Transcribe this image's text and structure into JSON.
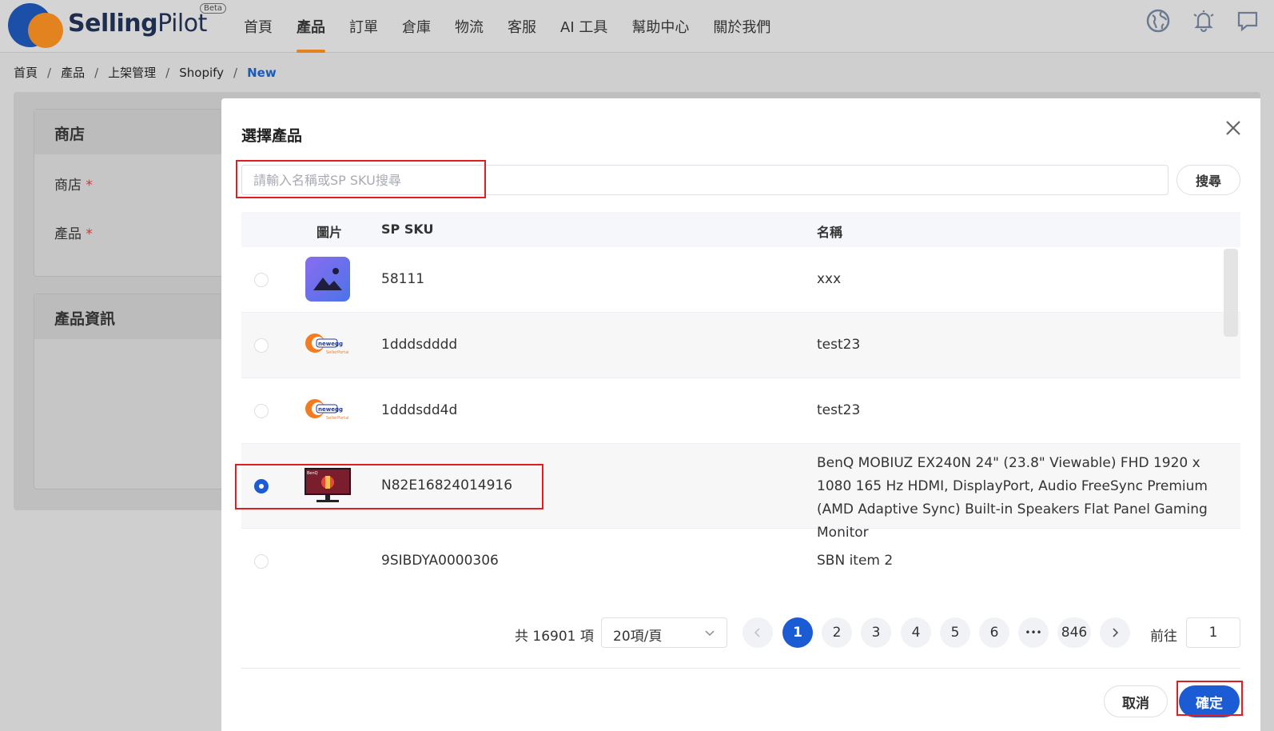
{
  "header": {
    "logo_bold": "Selling",
    "logo_light": "Pilot",
    "beta": "Beta",
    "nav": [
      "首頁",
      "產品",
      "訂單",
      "倉庫",
      "物流",
      "客服",
      "AI 工具",
      "幫助中心",
      "關於我們"
    ],
    "active_nav": "產品",
    "icons": [
      "globe-icon",
      "bell-icon",
      "message-icon"
    ]
  },
  "breadcrumb": [
    "首頁",
    "產品",
    "上架管理",
    "Shopify",
    "New"
  ],
  "form": {
    "store_card_title": "商店",
    "store_label": "商店",
    "product_label": "產品",
    "required_mark": "*",
    "info_card_title": "產品資訊"
  },
  "modal": {
    "title": "選擇產品",
    "search_placeholder": "請輸入名稱或SP SKU搜尋",
    "search_button": "搜尋",
    "columns": {
      "image": "圖片",
      "sku": "SP SKU",
      "name": "名稱"
    },
    "rows": [
      {
        "sku": "58111",
        "name": "xxx",
        "image": "placeholder-image-icon",
        "selected": false
      },
      {
        "sku": "1dddsdddd",
        "name": "test23",
        "image": "newegg-logo",
        "selected": false
      },
      {
        "sku": "1dddsdd4d",
        "name": "test23",
        "image": "newegg-logo",
        "selected": false
      },
      {
        "sku": "N82E16824014916",
        "name": "BenQ MOBIUZ EX240N 24\" (23.8\" Viewable) FHD 1920 x 1080 165 Hz HDMI, DisplayPort, Audio FreeSync Premium (AMD Adaptive Sync) Built-in Speakers Flat Panel Gaming Monitor",
        "image": "monitor-thumbnail",
        "selected": true
      },
      {
        "sku": "9SIBDYA0000306",
        "name": "SBN item 2",
        "image": "",
        "selected": false
      }
    ],
    "pagination": {
      "total": "共 16901 項",
      "page_size": "20項/頁",
      "pages": [
        "1",
        "2",
        "3",
        "4",
        "5",
        "6",
        "•••",
        "846"
      ],
      "current": "1",
      "goto_label": "前往",
      "goto_value": "1"
    },
    "cancel_button": "取消",
    "confirm_button": "確定",
    "highlight_color": "#e11d22",
    "accent_color": "#1b5bd4"
  }
}
